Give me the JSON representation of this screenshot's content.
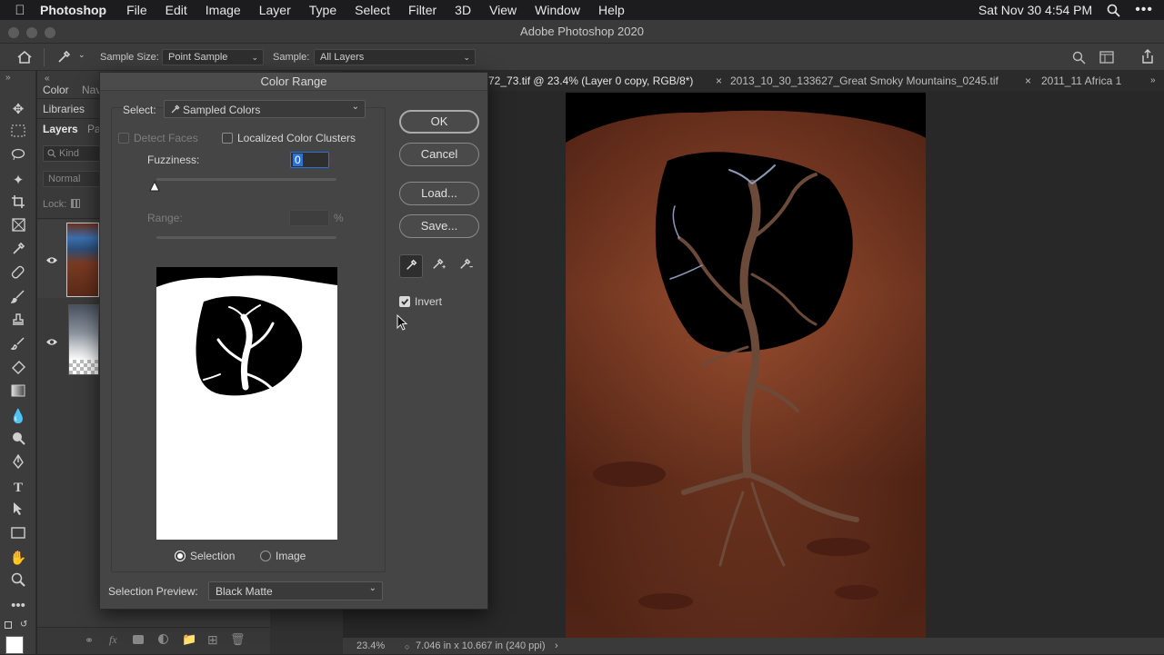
{
  "menubar": {
    "app_name": "Photoshop",
    "items": [
      "File",
      "Edit",
      "Image",
      "Layer",
      "Type",
      "Select",
      "Filter",
      "3D",
      "View",
      "Window",
      "Help"
    ],
    "clock": "Sat Nov 30  4:54 PM"
  },
  "window": {
    "title": "Adobe Photoshop 2020"
  },
  "options_bar": {
    "sample_size_label": "Sample Size:",
    "sample_size_value": "Point Sample",
    "sample_label": "Sample:",
    "sample_value": "All Layers"
  },
  "panels": {
    "tab_color": "Color",
    "tab_navigator": "Nav",
    "tab_libraries": "Libraries",
    "tab_layers": "Layers",
    "tab_paths": "Pa",
    "kind_placeholder": "Kind",
    "blend_mode": "Normal",
    "lock_label": "Lock:"
  },
  "doc_tabs": [
    "72_73.tif @ 23.4% (Layer 0 copy, RGB/8*)",
    "2013_10_30_133627_Great Smoky Mountains_0245.tif",
    "2011_11 Africa 1"
  ],
  "status": {
    "zoom": "23.4%",
    "doc_info": "7.046 in x 10.667 in (240 ppi)"
  },
  "dialog": {
    "title": "Color Range",
    "select_label": "Select:",
    "select_value": "Sampled Colors",
    "detect_faces": "Detect Faces",
    "localized_clusters": "Localized Color Clusters",
    "fuzziness_label": "Fuzziness:",
    "fuzziness_value": "0",
    "range_label": "Range:",
    "range_unit": "%",
    "ok": "OK",
    "cancel": "Cancel",
    "load": "Load...",
    "save": "Save...",
    "invert_label": "Invert",
    "invert_checked": true,
    "radio_selection": "Selection",
    "radio_image": "Image",
    "preview_label": "Selection Preview:",
    "preview_value": "Black Matte"
  },
  "colors": {
    "accent": "#2f6fd6",
    "rock": "#7a3a22"
  }
}
